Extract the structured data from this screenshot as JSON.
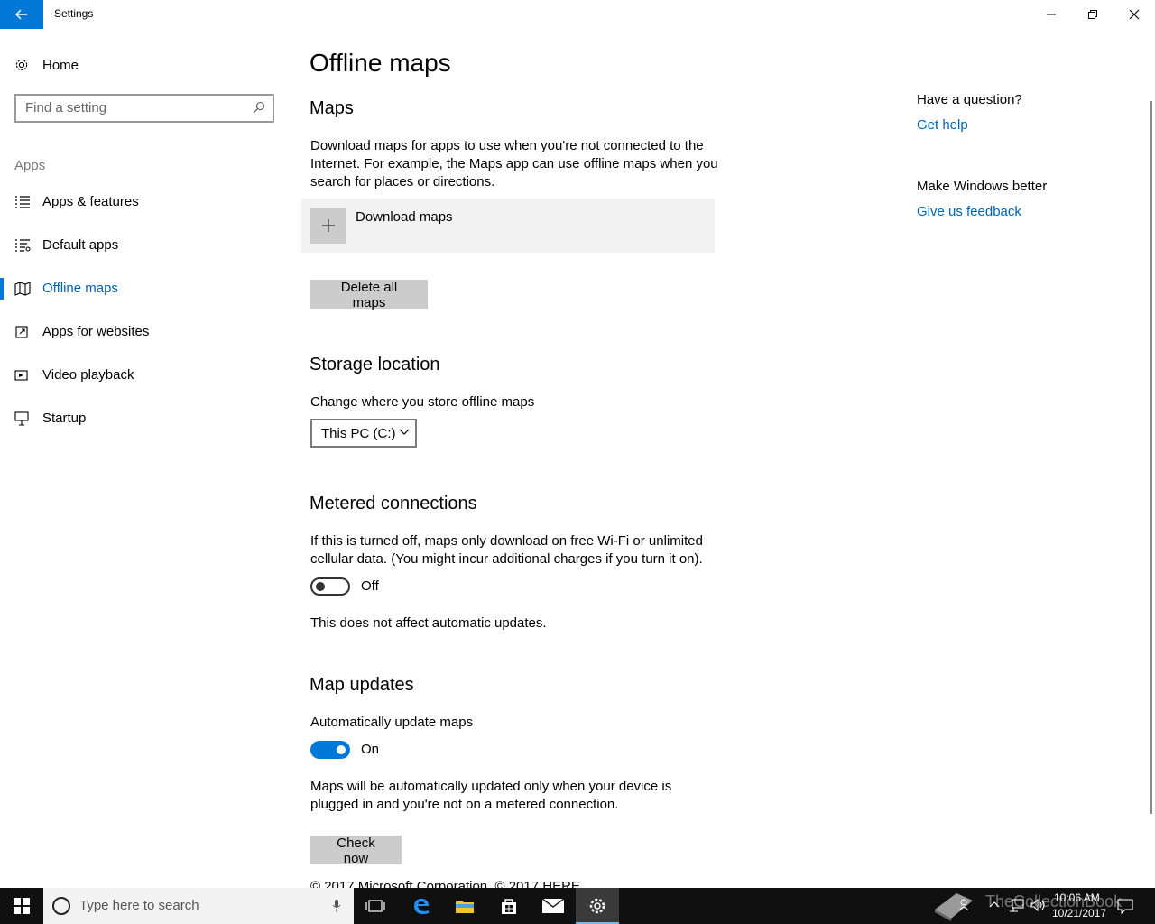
{
  "window": {
    "title": "Settings"
  },
  "sidebar": {
    "home_label": "Home",
    "search_placeholder": "Find a setting",
    "section_label": "Apps",
    "items": [
      {
        "label": "Apps & features",
        "icon": "apps-features-icon"
      },
      {
        "label": "Default apps",
        "icon": "default-apps-icon"
      },
      {
        "label": "Offline maps",
        "icon": "offline-maps-icon",
        "active": true
      },
      {
        "label": "Apps for websites",
        "icon": "apps-for-websites-icon"
      },
      {
        "label": "Video playback",
        "icon": "video-playback-icon"
      },
      {
        "label": "Startup",
        "icon": "startup-icon"
      }
    ]
  },
  "main": {
    "title": "Offline maps",
    "maps": {
      "heading": "Maps",
      "description": "Download maps for apps to use when you're not connected to the Internet. For example, the Maps app can use offline maps when you search for places or directions.",
      "download_label": "Download maps",
      "delete_label": "Delete all maps"
    },
    "storage": {
      "heading": "Storage location",
      "description": "Change where you store offline maps",
      "selected": "This PC (C:)"
    },
    "metered": {
      "heading": "Metered connections",
      "description": "If this is turned off, maps only download on free Wi-Fi or unlimited cellular data. (You might incur additional charges if you turn it on).",
      "toggle_state": "Off",
      "note": "This does not affect automatic updates."
    },
    "updates": {
      "heading": "Map updates",
      "description": "Automatically update maps",
      "toggle_state": "On",
      "note": "Maps will be automatically updated only when your device is plugged in and you're not on a metered connection.",
      "check_label": "Check now"
    },
    "copyright": "© 2017 Microsoft Corporation, © 2017 HERE"
  },
  "right": {
    "question_heading": "Have a question?",
    "help_link": "Get help",
    "better_heading": "Make Windows better",
    "feedback_link": "Give us feedback"
  },
  "taskbar": {
    "search_placeholder": "Type here to search",
    "time": "10:06 AM",
    "date": "10/21/2017",
    "watermark": "TheCollectionBook"
  },
  "colors": {
    "accent": "#0078d7",
    "link": "#0063b1",
    "taskbar": "#101010"
  }
}
